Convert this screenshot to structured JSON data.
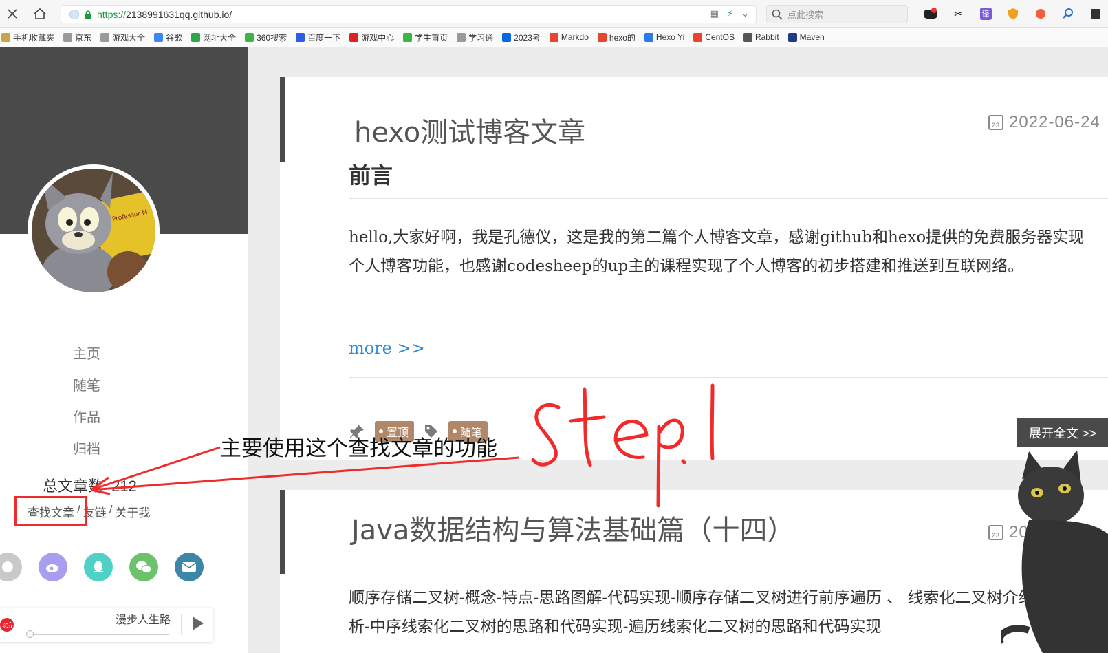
{
  "browser": {
    "url_scheme": "https://",
    "url_host": "2138991631qq.github.io/",
    "search_placeholder": "点此搜索"
  },
  "bookmarks": [
    {
      "label": "手机收藏夹",
      "icon": "folder-icon"
    },
    {
      "label": "京东",
      "icon": "page-icon"
    },
    {
      "label": "游戏大全",
      "icon": "page-icon"
    },
    {
      "label": "谷歌",
      "icon": "google-icon"
    },
    {
      "label": "网址大全",
      "icon": "web-icon"
    },
    {
      "label": "360搜索",
      "icon": "360-icon"
    },
    {
      "label": "百度一下",
      "icon": "baidu-icon"
    },
    {
      "label": "游戏中心",
      "icon": "game-icon"
    },
    {
      "label": "学生首页",
      "icon": "student-icon"
    },
    {
      "label": "学习通",
      "icon": "page-icon"
    },
    {
      "label": "2023考",
      "icon": "zhihu-icon"
    },
    {
      "label": "Markdo",
      "icon": "csdn-icon"
    },
    {
      "label": "hexo的",
      "icon": "csdn-icon"
    },
    {
      "label": "Hexo Yi",
      "icon": "hexo-icon"
    },
    {
      "label": "CentOS",
      "icon": "csdn-icon"
    },
    {
      "label": "Rabbit",
      "icon": "rabbit-icon"
    },
    {
      "label": "Maven",
      "icon": "maven-icon"
    }
  ],
  "sidebar": {
    "menu": [
      "主页",
      "随笔",
      "作品",
      "归档"
    ],
    "total_label": "总文章数",
    "total_count": "212",
    "links": [
      "查找文章",
      "/",
      "友链",
      "/",
      "关于我"
    ],
    "player_song": "漫步人生路"
  },
  "posts": [
    {
      "title": "hexo测试博客文章",
      "date": "2022-06-24",
      "heading": "前言",
      "paragraph": "hello,大家好啊，我是孔德仪，这是我的第二篇个人博客文章，感谢github和hexo提供的免费服务器实现个人博客功能，也感谢codesheep的up主的课程实现了个人博客的初步搭建和推送到互联网络。",
      "more": "more >>",
      "tags": [
        "置顶",
        "随笔"
      ],
      "read_more": "展开全文 >>"
    },
    {
      "title": "Java数据结构与算法基础篇（十四）",
      "date": "202",
      "paragraph": "顺序存储二叉树-概念-特点-思路图解-代码实现-顺序存储二叉树进行前序遍历 、 线索化二叉树介绍-思路分析-中序线索化二叉树的思路和代码实现-遍历线索化二叉树的思路和代码实现"
    }
  ],
  "annotation": {
    "text": "主要使用这个查找文章的功能",
    "handwriting": "step.1",
    "color": "#ef2b2b"
  },
  "colors": {
    "sidebar_dark": "#4a4a4a",
    "tag_brown": "#b08768",
    "link_blue": "#2a8bd8"
  }
}
